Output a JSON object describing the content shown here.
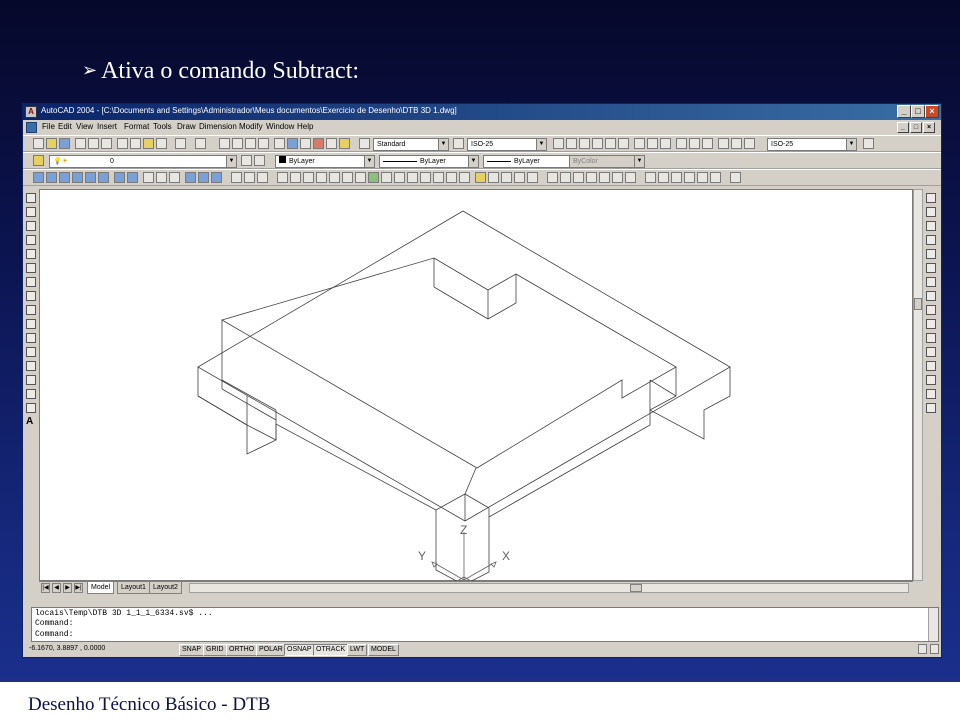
{
  "slide": {
    "title": "Ativa o comando Subtract:",
    "footer": "Desenho Técnico Básico - DTB"
  },
  "window": {
    "title": "AutoCAD 2004 - [C:\\Documents and Settings\\Administrador\\Meus documentos\\Exercicio de Desenho\\DTB 3D 1.dwg]"
  },
  "menu": [
    "File",
    "Edit",
    "View",
    "Insert",
    "Format",
    "Tools",
    "Draw",
    "Dimension",
    "Modify",
    "Window",
    "Help"
  ],
  "toolbar": {
    "text_style": "Standard",
    "dim_style": "ISO-25",
    "dim_style_right": "ISO-25",
    "layer": "0",
    "color": "ByLayer",
    "linetype": "ByLayer",
    "lineweight": "ByLayer",
    "plot_style": "ByColor"
  },
  "tabs": [
    "Model",
    "Layout1",
    "Layout2"
  ],
  "ucs": {
    "x": "X",
    "y": "Y",
    "z": "Z"
  },
  "command": {
    "lines": [
      "locais\\Temp\\DTB 3D 1_1_1_6334.sv$ ...",
      "Command:",
      "Command:"
    ]
  },
  "status": {
    "coords": "-6.1670, 3.8897 , 0.0000",
    "buttons": [
      "SNAP",
      "GRID",
      "ORTHO",
      "POLAR",
      "OSNAP",
      "OTRACK",
      "LWT",
      "MODEL"
    ]
  }
}
